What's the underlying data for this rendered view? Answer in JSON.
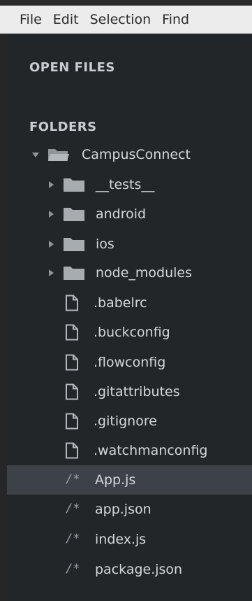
{
  "menubar": {
    "items": [
      "File",
      "Edit",
      "Selection",
      "Find"
    ]
  },
  "sidebar": {
    "open_files_title": "OPEN FILES",
    "folders_title": "FOLDERS",
    "root_folder": "CampusConnect",
    "folders": [
      "__tests__",
      "android",
      "ios",
      "node_modules"
    ],
    "dotfiles": [
      ".babelrc",
      ".buckconfig",
      ".flowconfig",
      ".gitattributes",
      ".gitignore",
      ".watchmanconfig"
    ],
    "code_icon_glyph": "/*",
    "js_files": [
      "App.js",
      "app.json",
      "index.js",
      "package.json"
    ],
    "selected_file": "App.js"
  },
  "colors": {
    "menubar_bg": "#ececec",
    "sidebar_bg": "#232629",
    "selection_bg": "#3d4248",
    "text": "#d5d8db"
  }
}
